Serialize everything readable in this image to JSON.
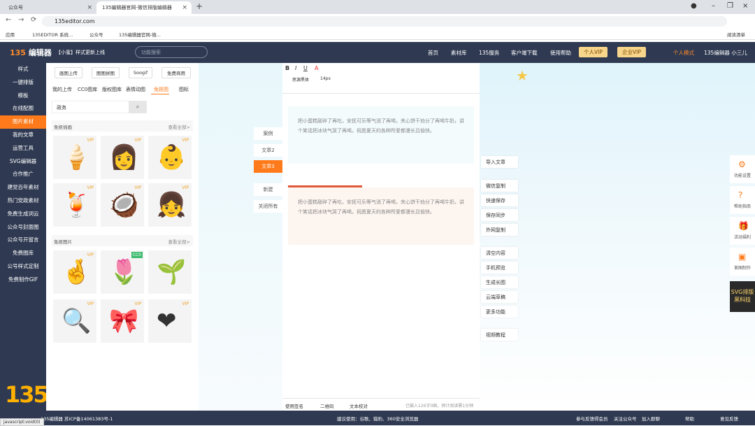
{
  "browser": {
    "tabs": [
      {
        "title": "公众号"
      },
      {
        "title": "135编辑器官网-微信排版编辑器"
      }
    ],
    "url": "135editor.com",
    "bookmarks": [
      "应用",
      "135EDITOR 系统...",
      "公众号",
      "135编辑器官网-微...",
      "阅读清单"
    ]
  },
  "topnav": {
    "logo_num": "135",
    "logo_text": "编辑器",
    "announcement": "【小蜜】样式更新上线",
    "search_placeholder": "功能搜索",
    "links": [
      "首页",
      "素材库",
      "135服务",
      "客户端下载",
      "使用帮助"
    ],
    "vip_personal": "个人VIP",
    "vip_enterprise": "企业VIP",
    "mode": "个人模式",
    "user": "135编辑器 小三儿"
  },
  "sidebar": {
    "items": [
      "样式",
      "一键排版",
      "模板",
      "在线配图",
      "图片素材",
      "我的文章",
      "运营工具",
      "SVG编辑器",
      "合作推广",
      "建党百年素材",
      "热门党政素材",
      "免费生成词云",
      "公众号封面图",
      "公众号开留言",
      "免费图库",
      "公号样式定制",
      "免费制作GIF"
    ],
    "active_index": 4
  },
  "panel": {
    "buttons": [
      "画图上传",
      "图图拼图",
      "Soogif",
      "免费商用"
    ],
    "tabs": [
      "我的上传",
      "CC0图库",
      "版权图库",
      "表情动图",
      "免抠图",
      "图标"
    ],
    "active_tab": "免抠图",
    "search_value": "政务",
    "section1": {
      "title": "免抠插画",
      "more": "查看全部>"
    },
    "section2": {
      "title": "免抠图片",
      "more": "查看全部>"
    },
    "vip_label": "VIP",
    "cc0_label": "CC0",
    "items1": [
      "ice-cream",
      "girl",
      "baby",
      "drink",
      "coconut",
      "doll"
    ],
    "items2": [
      "fingers",
      "flower",
      "sprout",
      "magnifier",
      "ribbon",
      "heart"
    ]
  },
  "side_tabs": [
    "案例",
    "文章2",
    "文章3",
    "新建",
    "关闭所有"
  ],
  "editor": {
    "font": "思源黑体",
    "font_size": "14px",
    "text": "把小蛋糕敲碎了再吃，安抚可乐等气消了再喝，夹心饼干劝分了再喝牛奶，讲个笑话把冰块气哭了再喝，祝愿夏天的各种所爱都漫长且愉快。",
    "footer": [
      "使用签名",
      "二维码",
      "文本校对"
    ],
    "count": "已输入126字0图，预计阅读需1分钟"
  },
  "actions": [
    "导入文章",
    "微信复制",
    "快速保存",
    "保存同步",
    "外网复制",
    "清空内容",
    "手机预览",
    "生成长图",
    "云端草稿",
    "更多功能",
    "视频教程"
  ],
  "right_tools": [
    "功能设置",
    "帮助指南",
    "活动福利",
    "首图制作"
  ],
  "svg_ad": [
    "SVG排版",
    "黑科技"
  ],
  "status": {
    "left": "135编辑器  苏ICP备14061383号-1",
    "mid": "建议使用：谷歌、猎豹、360安全浏览器",
    "links": [
      "参与反馈得会员",
      "关注公众号",
      "加入群聊"
    ],
    "help": "帮助",
    "feedback": "意见反馈",
    "js": "javascript:void(0)"
  }
}
